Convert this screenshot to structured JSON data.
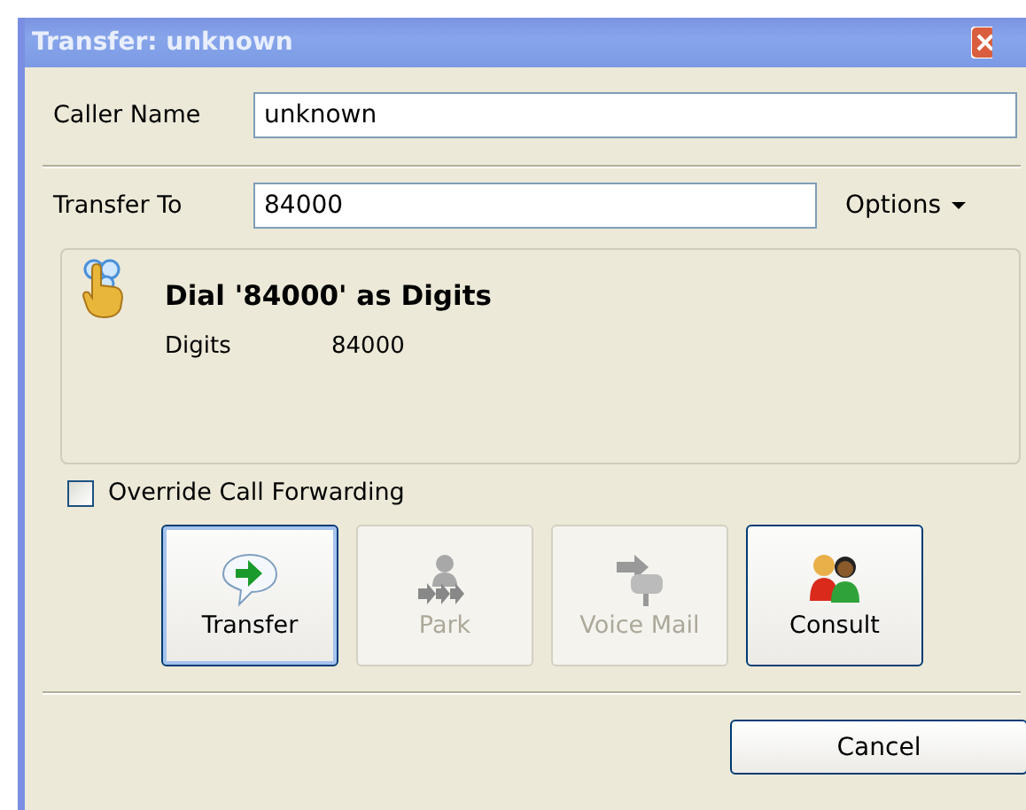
{
  "window": {
    "title": "Transfer: unknown"
  },
  "caller_name": {
    "label": "Caller Name",
    "value": "unknown"
  },
  "transfer_to": {
    "label": "Transfer To",
    "value": "84000"
  },
  "options": {
    "label": "Options"
  },
  "dial_panel": {
    "heading": "Dial '84000' as Digits",
    "rows": [
      {
        "label": "Digits",
        "value": "84000"
      }
    ]
  },
  "override_call_forwarding": {
    "label": "Override Call Forwarding",
    "checked": false
  },
  "actions": [
    {
      "kind": "transfer",
      "label": "Transfer",
      "disabled": false,
      "focused": true
    },
    {
      "kind": "park",
      "label": "Park",
      "disabled": true,
      "focused": false
    },
    {
      "kind": "voicemail",
      "label": "Voice Mail",
      "disabled": true,
      "focused": false
    },
    {
      "kind": "consult",
      "label": "Consult",
      "disabled": false,
      "focused": false
    }
  ],
  "cancel": {
    "label": "Cancel"
  }
}
